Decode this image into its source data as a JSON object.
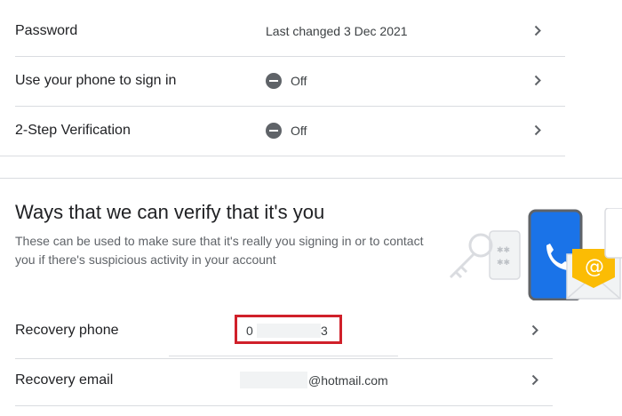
{
  "signin": {
    "password": {
      "label": "Password",
      "value": "Last changed 3 Dec 2021"
    },
    "phone_signin": {
      "label": "Use your phone to sign in",
      "value": "Off"
    },
    "two_step": {
      "label": "2-Step Verification",
      "value": "Off"
    }
  },
  "verify": {
    "title": "Ways that we can verify that it's you",
    "description": "These can be used to make sure that it's really you signing in or to contact you if there's suspicious activity in your account",
    "recovery_phone": {
      "label": "Recovery phone",
      "value_start": "0",
      "value_end": "3"
    },
    "recovery_email": {
      "label": "Recovery email",
      "value_suffix": "@hotmail.com"
    }
  },
  "colors": {
    "highlight": "#d0202a",
    "phone": "#1a73e8",
    "email_badge": "#fbbc04"
  }
}
